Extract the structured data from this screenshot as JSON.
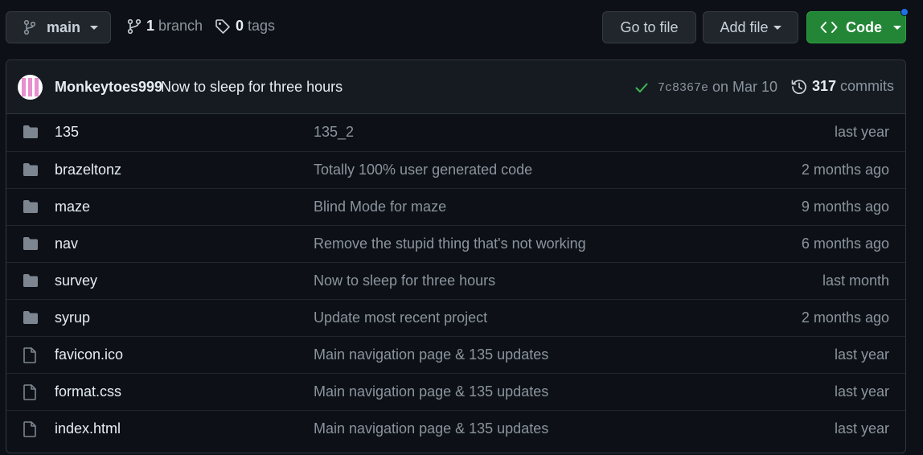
{
  "toolbar": {
    "branch_label": "main",
    "branches_count": "1",
    "branches_label": "branch",
    "tags_count": "0",
    "tags_label": "tags",
    "go_to_file": "Go to file",
    "add_file": "Add file",
    "code": "Code"
  },
  "colors": {
    "background": "#0d1117",
    "accent_green": "#238636",
    "notification_blue": "#1f6feb",
    "success_check": "#3fb950"
  },
  "latest_commit": {
    "author": "Monkeytoes999",
    "message": "Now to sleep for three hours",
    "sha": "7c8367e",
    "date": "on Mar 10",
    "commits_count": "317",
    "commits_label": "commits"
  },
  "files": [
    {
      "type": "folder",
      "icon": "folder-icon",
      "name": "135",
      "message": "135_2",
      "age": "last year"
    },
    {
      "type": "folder",
      "icon": "folder-icon",
      "name": "brazeltonz",
      "message": "Totally 100% user generated code",
      "age": "2 months ago"
    },
    {
      "type": "folder",
      "icon": "folder-icon",
      "name": "maze",
      "message": "Blind Mode for maze",
      "age": "9 months ago"
    },
    {
      "type": "folder",
      "icon": "folder-icon",
      "name": "nav",
      "message": "Remove the stupid thing that's not working",
      "age": "6 months ago"
    },
    {
      "type": "folder",
      "icon": "folder-icon",
      "name": "survey",
      "message": "Now to sleep for three hours",
      "age": "last month"
    },
    {
      "type": "folder",
      "icon": "folder-icon",
      "name": "syrup",
      "message": "Update most recent project",
      "age": "2 months ago"
    },
    {
      "type": "file",
      "icon": "file-icon",
      "name": "favicon.ico",
      "message": "Main navigation page & 135 updates",
      "age": "last year"
    },
    {
      "type": "file",
      "icon": "file-icon",
      "name": "format.css",
      "message": "Main navigation page & 135 updates",
      "age": "last year"
    },
    {
      "type": "file",
      "icon": "file-icon",
      "name": "index.html",
      "message": "Main navigation page & 135 updates",
      "age": "last year"
    }
  ]
}
